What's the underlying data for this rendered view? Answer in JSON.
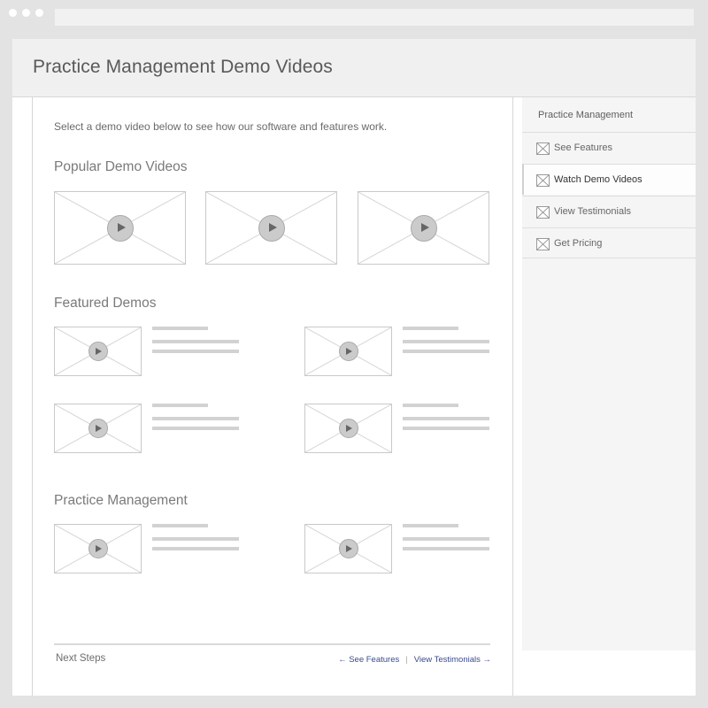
{
  "page": {
    "title": "Practice Management Demo Videos"
  },
  "main": {
    "intro": "Select a demo video below to see how our software and features work.",
    "sections": [
      {
        "title": "Popular Demo Videos"
      },
      {
        "title": "Featured Demos"
      },
      {
        "title": "Practice Management"
      }
    ],
    "footer": {
      "label": "Next Steps",
      "prev_link": "← See Features",
      "separator": "|",
      "next_link": "View Testimonials →"
    }
  },
  "sidebar": {
    "heading": "Practice Management",
    "items": [
      {
        "label": "See Features",
        "icon": "placeholder-icon",
        "active": false
      },
      {
        "label": "Watch Demo Videos",
        "icon": "placeholder-icon",
        "active": true
      },
      {
        "label": "View Testimonials",
        "icon": "placeholder-icon",
        "active": false
      },
      {
        "label": "Get Pricing",
        "icon": "placeholder-icon",
        "active": false
      }
    ]
  }
}
